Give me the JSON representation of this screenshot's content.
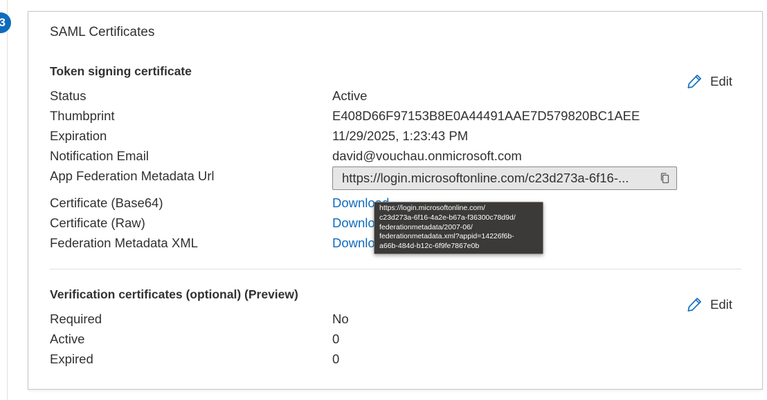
{
  "step": {
    "number": "3"
  },
  "card": {
    "title": "SAML Certificates"
  },
  "token_signing": {
    "title": "Token signing certificate",
    "edit_label": "Edit",
    "rows": [
      {
        "label": "Status",
        "value": "Active"
      },
      {
        "label": "Thumbprint",
        "value": "E408D66F97153B8E0A44491AAE7D579820BC1AEE"
      },
      {
        "label": "Expiration",
        "value": "11/29/2025, 1:23:43 PM"
      },
      {
        "label": "Notification Email",
        "value": "david@vouchau.onmicrosoft.com"
      }
    ],
    "metadata_url": {
      "label": "App Federation Metadata Url",
      "value": "https://login.microsoftonline.com/c23d273a-6f16-..."
    },
    "downloads": [
      {
        "label": "Certificate (Base64)",
        "link": "Download"
      },
      {
        "label": "Certificate (Raw)",
        "link": "Download"
      },
      {
        "label": "Federation Metadata XML",
        "link": "Download"
      }
    ]
  },
  "tooltip": {
    "lines": [
      "https://login.microsoftonline.com/",
      "c23d273a-6f16-4a2e-b67a-f36300c78d9d/",
      "federationmetadata/2007-06/",
      "federationmetadata.xml?appid=14226f6b-",
      "a66b-484d-b12c-6f9fe7867e0b"
    ]
  },
  "verification": {
    "title": "Verification certificates (optional) (Preview)",
    "edit_label": "Edit",
    "rows": [
      {
        "label": "Required",
        "value": "No"
      },
      {
        "label": "Active",
        "value": "0"
      },
      {
        "label": "Expired",
        "value": "0"
      }
    ]
  },
  "colors": {
    "accent": "#0f6cbd",
    "text": "#323130",
    "tooltip_bg": "#3b3a39"
  }
}
